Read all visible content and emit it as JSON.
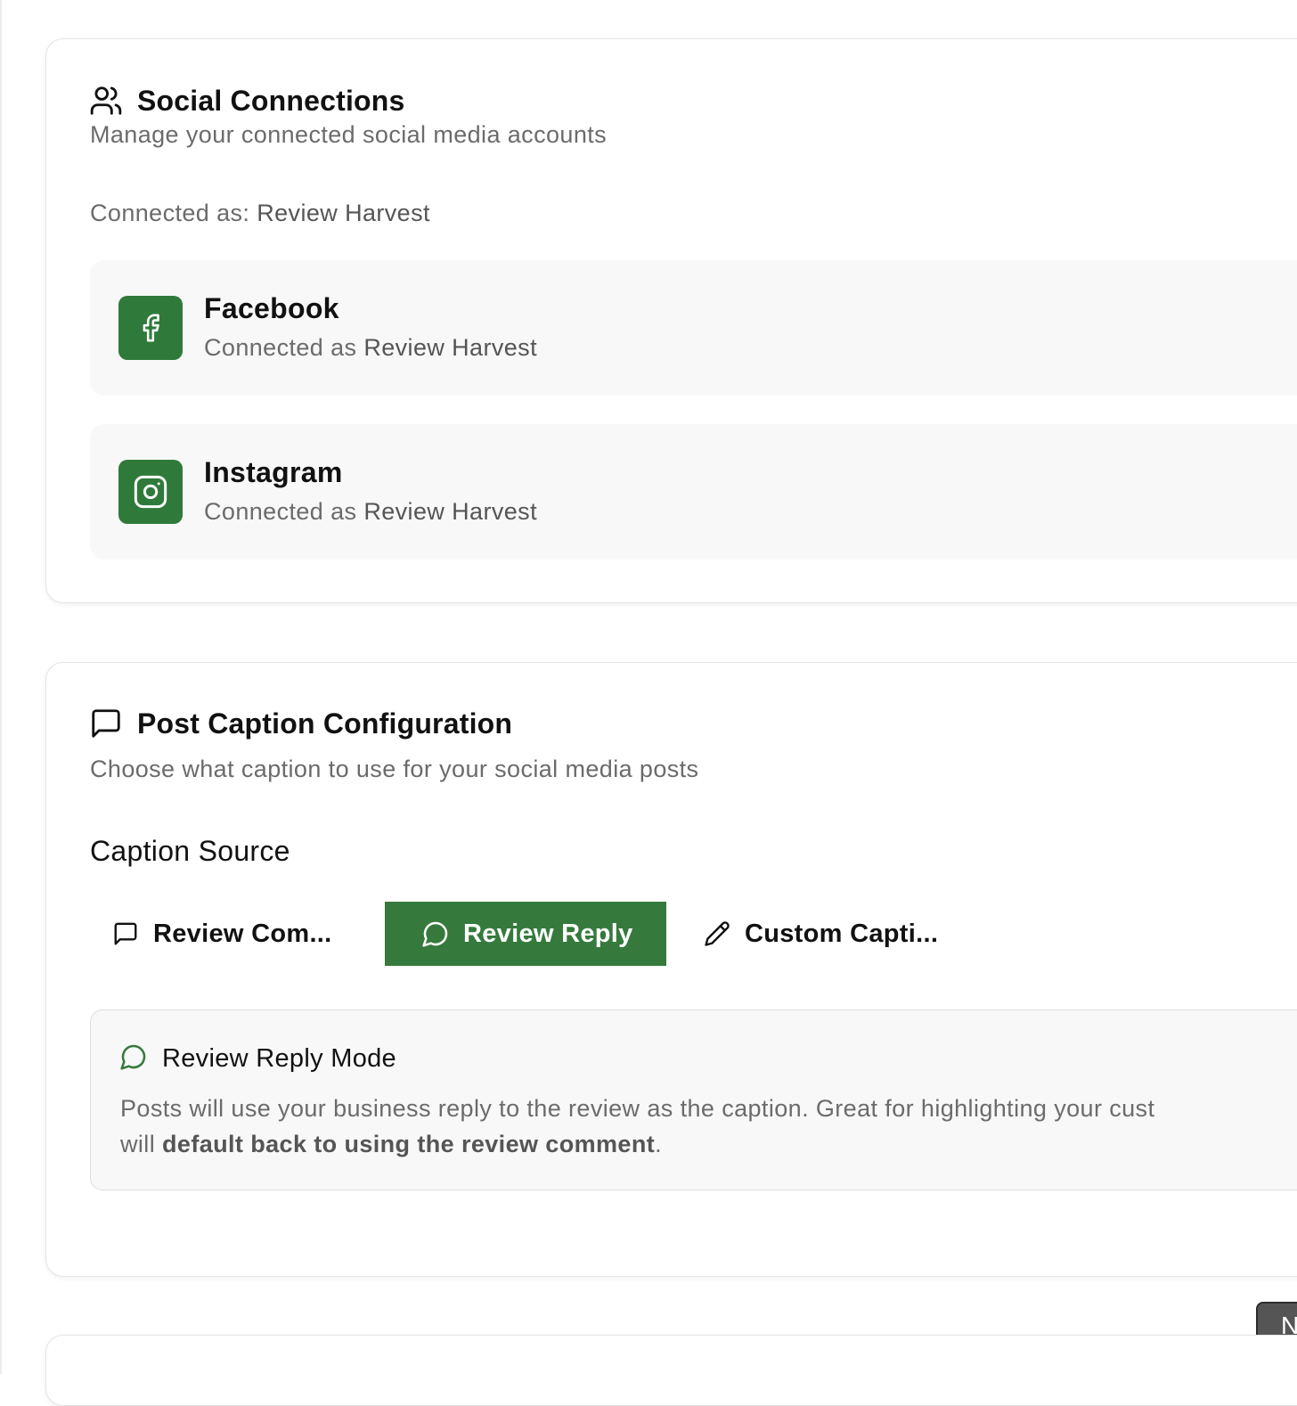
{
  "social_connections": {
    "title": "Social Connections",
    "subtitle": "Manage your connected social media accounts",
    "connected_as_label": "Connected as:",
    "connected_as_name": "Review Harvest",
    "accounts": [
      {
        "name": "Facebook",
        "status_prefix": "Connected as",
        "account_name": "Review Harvest",
        "icon": "facebook-icon"
      },
      {
        "name": "Instagram",
        "status_prefix": "Connected as",
        "account_name": "Review Harvest",
        "icon": "instagram-icon"
      }
    ]
  },
  "post_caption": {
    "title": "Post Caption Configuration",
    "subtitle": "Choose what caption to use for your social media posts",
    "caption_source_label": "Caption Source",
    "options": [
      {
        "label": "Review Com...",
        "icon": "message-square-icon",
        "selected": false
      },
      {
        "label": "Review Reply",
        "icon": "message-circle-icon",
        "selected": true
      },
      {
        "label": "Custom Capti...",
        "icon": "pencil-icon",
        "selected": false
      }
    ],
    "mode": {
      "title": "Review Reply Mode",
      "desc_line1": "Posts will use your business reply to the review as the caption. Great for highlighting your cust",
      "desc_line2_prefix": "will",
      "desc_line2_bold": "default back to using the review comment",
      "desc_line2_suffix": "."
    }
  },
  "corner_button": {
    "label": "N"
  },
  "colors": {
    "accent_green": "#357a3c",
    "muted_text": "#6b6b6b",
    "panel_bg": "#f8f8f8"
  }
}
